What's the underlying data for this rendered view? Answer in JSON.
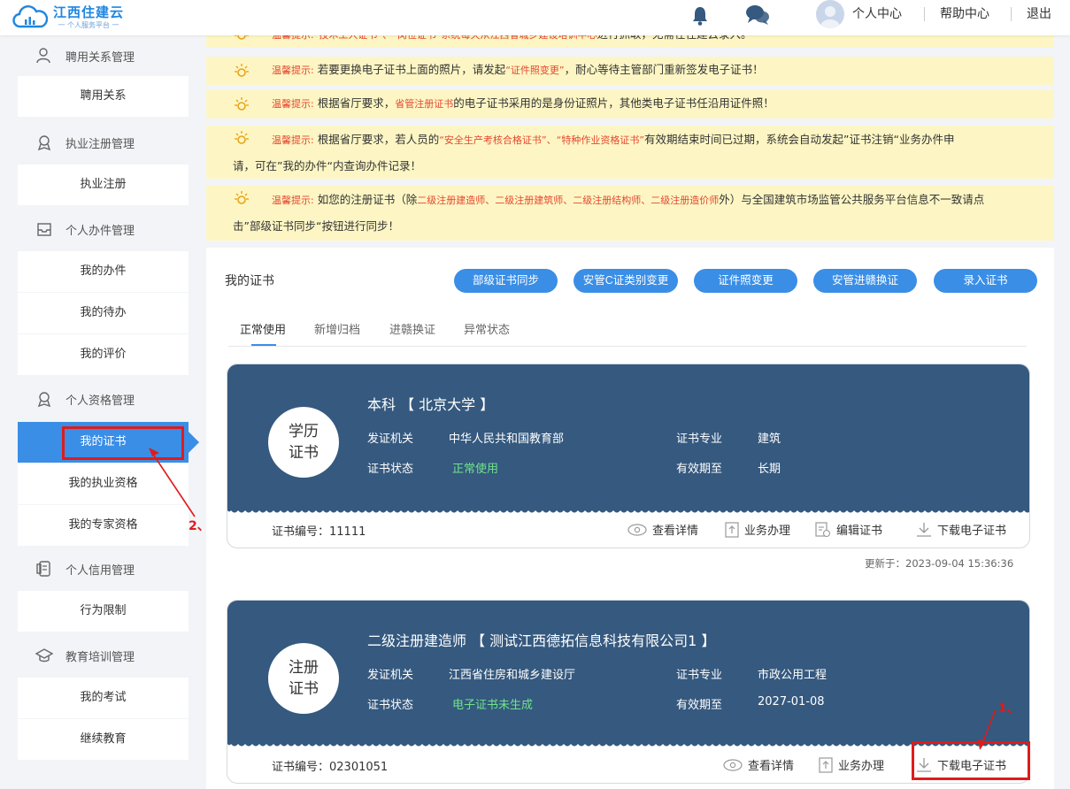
{
  "header": {
    "logo_title": "江西住建云",
    "logo_sub": "一 个人服务平台 一",
    "links": [
      "个人中心",
      "帮助中心",
      "退出"
    ]
  },
  "sidebar": {
    "groups": [
      {
        "label": "聘用关系管理",
        "icon": "user-icon",
        "items": [
          "聘用关系"
        ]
      },
      {
        "label": "执业注册管理",
        "icon": "badge-icon",
        "items": [
          "执业注册"
        ]
      },
      {
        "label": "个人办件管理",
        "icon": "inbox-icon",
        "items": [
          "我的办件",
          "我的待办",
          "我的评价"
        ]
      },
      {
        "label": "个人资格管理",
        "icon": "badge-icon",
        "items": [
          "我的证书",
          "我的执业资格",
          "我的专家资格"
        ]
      },
      {
        "label": "个人信用管理",
        "icon": "credit-icon",
        "items": [
          "行为限制"
        ]
      },
      {
        "label": "教育培训管理",
        "icon": "graduation-icon",
        "items": [
          "我的考试",
          "继续教育"
        ]
      }
    ],
    "active_item": "我的证书"
  },
  "notices": {
    "label": "温馨提示:",
    "n0": {
      "a": "“技术工人证书”、“岗位证书”系统每天从",
      "red": "江西省城乡建设培训中心",
      "b": "进行抓取，无需在住建云录入。"
    },
    "n1": {
      "a": "若要更换电子证书上面的照片，请发起",
      "red": "“证件照变更”",
      "b": "，耐心等待主管部门重新签发电子证书！"
    },
    "n2": {
      "a": "根据省厅要求，",
      "red": "省管注册证书",
      "b": "的电子证书采用的是身份证照片，其他类电子证书任沿用证件照！"
    },
    "n3": {
      "a": "根据省厅要求，若人员的",
      "red": "“安全生产考核合格证书”、“特种作业资格证书”",
      "b": "有效期结束时间已过期，系统会自动发起”证书注销“业务办件申",
      "c": "请，可在”我的办件“内查询办件记录！"
    },
    "n4": {
      "a": "如您的注册证书（除",
      "red": "二级注册建造师、二级注册建筑师、二级注册结构师、二级注册造价师",
      "b": "外）与全国建筑市场监管公共服务平台信息不一致请点",
      "c": "击”部级证书同步“按钮进行同步！"
    }
  },
  "main": {
    "title": "我的证书",
    "buttons": [
      "部级证书同步",
      "安管C证类别变更",
      "证件照变更",
      "安管进赣换证",
      "录入证书"
    ],
    "tabs": [
      "正常使用",
      "新增归档",
      "进赣换证",
      "异常状态"
    ],
    "active_tab": "正常使用"
  },
  "cards": [
    {
      "seal": [
        "学历",
        "证书"
      ],
      "title": "本科 【 北京大学 】",
      "issuer_label": "发证机关",
      "issuer": "中华人民共和国教育部",
      "major_label": "证书专业",
      "major": "建筑",
      "status_label": "证书状态",
      "status": "正常使用",
      "valid_label": "有效期至",
      "valid": "长期",
      "cert_no": "证书编号：11111",
      "actions": [
        "查看详情",
        "业务办理",
        "编辑证书",
        "下载电子证书"
      ],
      "updated": "更新于：2023-09-04 15:36:36"
    },
    {
      "seal": [
        "注册",
        "证书"
      ],
      "title": "二级注册建造师 【 测试江西德拓信息科技有限公司1 】",
      "issuer_label": "发证机关",
      "issuer": "江西省住房和城乡建设厅",
      "major_label": "证书专业",
      "major": "市政公用工程",
      "status_label": "证书状态",
      "status": "电子证书未生成",
      "valid_label": "有效期至",
      "valid": "2027-01-08",
      "cert_no": "证书编号：02301051",
      "actions": [
        "查看详情",
        "业务办理",
        "下载电子证书"
      ]
    }
  ],
  "annotations": [
    "2、",
    "1、"
  ],
  "colors": {
    "accent": "#3a8ee6",
    "card": "#35597f",
    "notice": "#fdf6c4",
    "annotation": "#e01b1b",
    "green": "#6fe48a"
  }
}
